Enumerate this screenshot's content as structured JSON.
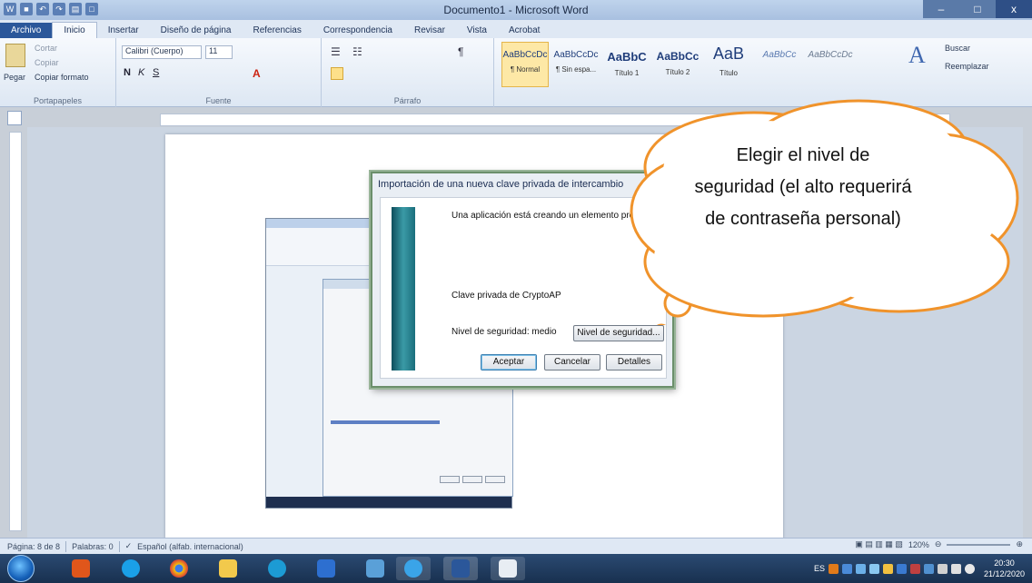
{
  "window": {
    "title": "Documento1 - Microsoft Word",
    "controls": [
      "–",
      "□",
      "x"
    ]
  },
  "quick_access": [
    "save-icon",
    "undo-icon",
    "redo-icon",
    "print-icon",
    "new-icon"
  ],
  "tabs": [
    {
      "label": "Archivo"
    },
    {
      "label": "Inicio"
    },
    {
      "label": "Insertar"
    },
    {
      "label": "Diseño de página"
    },
    {
      "label": "Referencias"
    },
    {
      "label": "Correspondencia"
    },
    {
      "label": "Revisar"
    },
    {
      "label": "Vista"
    },
    {
      "label": "Acrobat"
    }
  ],
  "ribbon": {
    "clipboard": {
      "label": "Portapapeles",
      "paste": "Pegar",
      "cut": "Cortar",
      "copy": "Copiar",
      "format_painter": "Copiar formato"
    },
    "font": {
      "label": "Fuente",
      "font_name": "Calibri (Cuerpo)",
      "font_size": "11"
    },
    "paragraph": {
      "label": "Párrafo"
    },
    "styles": [
      {
        "preview": "AaBbCcDc",
        "name": "¶ Normal"
      },
      {
        "preview": "AaBbCcDc",
        "name": "¶ Sin espa..."
      },
      {
        "preview": "AaBbC",
        "name": "Título 1"
      },
      {
        "preview": "AaBbCc",
        "name": "Título 2"
      },
      {
        "preview": "AaB",
        "name": "Título"
      },
      {
        "preview": "AaBbCc",
        "name": ""
      },
      {
        "preview": "AaBbCcDc",
        "name": ""
      }
    ],
    "editing": {
      "find": "Buscar",
      "replace": "Reemplazar"
    }
  },
  "dialog": {
    "title": "Importación de una nueva clave privada de intercambio",
    "message": "Una aplicación está creando un elemento protegi",
    "key_name": "Clave privada de CryptoAP",
    "security_level": "Nivel de seguridad: medio",
    "security_button": "Nivel de seguridad...",
    "accept": "Aceptar",
    "cancel": "Cancelar",
    "details": "Detalles"
  },
  "callout": {
    "text": "Elegir el nivel de seguridad (el alto requerirá de contraseña personal)"
  },
  "status": {
    "page": "Página: 8 de 8",
    "words": "Palabras: 0",
    "language": "Español (alfab. internacional)",
    "zoom": "120%"
  },
  "taskbar": {
    "language": "ES",
    "time": "20:30",
    "date": "21/12/2020",
    "apps": [
      "start-icon",
      "office-icon",
      "skype-icon",
      "chrome-icon",
      "file-explorer-icon",
      "edge-icon",
      "security-icon",
      "network-icon",
      "internet-explorer-icon",
      "word-icon",
      "blank-window-icon"
    ]
  },
  "colors": {
    "accent": "#2b579a",
    "taskbar": "#1e3556",
    "dialog_border": "#6b8f6b"
  }
}
